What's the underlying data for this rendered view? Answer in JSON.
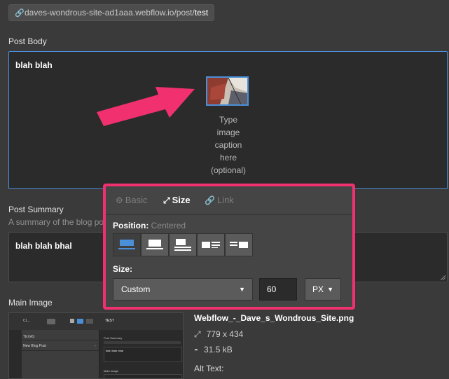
{
  "url_bar": {
    "prefix": "daves-wondrous-site-ad1aaa.webflow.io/post/",
    "slug": "test"
  },
  "post_body": {
    "label": "Post Body",
    "content": "blah blah",
    "caption": [
      "Type",
      "image",
      "caption",
      "here",
      "(optional)"
    ]
  },
  "post_summary": {
    "label": "Post Summary",
    "hint": "A summary of the blog po",
    "content": "blah blah bhal"
  },
  "main_image": {
    "label": "Main Image",
    "file_name": "Webflow_-_Dave_s_Wondrous_Site.png",
    "dimensions": "779 x 434",
    "file_size": "31.5 kB",
    "alt_label": "Alt Text:",
    "preview": {
      "header": "CL...",
      "row1": "TEXAS",
      "row2": "New Blog Post",
      "col_title": "TEST",
      "summary_label": "Post Summary",
      "summary_text": "blah blah bhal",
      "main_image_label": "Main Image"
    }
  },
  "popover": {
    "tabs": [
      {
        "label": "Basic",
        "icon": "gear-icon"
      },
      {
        "label": "Size",
        "icon": "resize-icon"
      },
      {
        "label": "Link",
        "icon": "link-icon"
      }
    ],
    "position_label": "Position:",
    "position_value": "Centered",
    "size_label": "Size:",
    "size_mode": "Custom",
    "size_value": "60",
    "unit": "PX"
  },
  "colors": {
    "accent": "#f0306f",
    "focus": "#4a90d9",
    "background": "#3a3a3a"
  }
}
